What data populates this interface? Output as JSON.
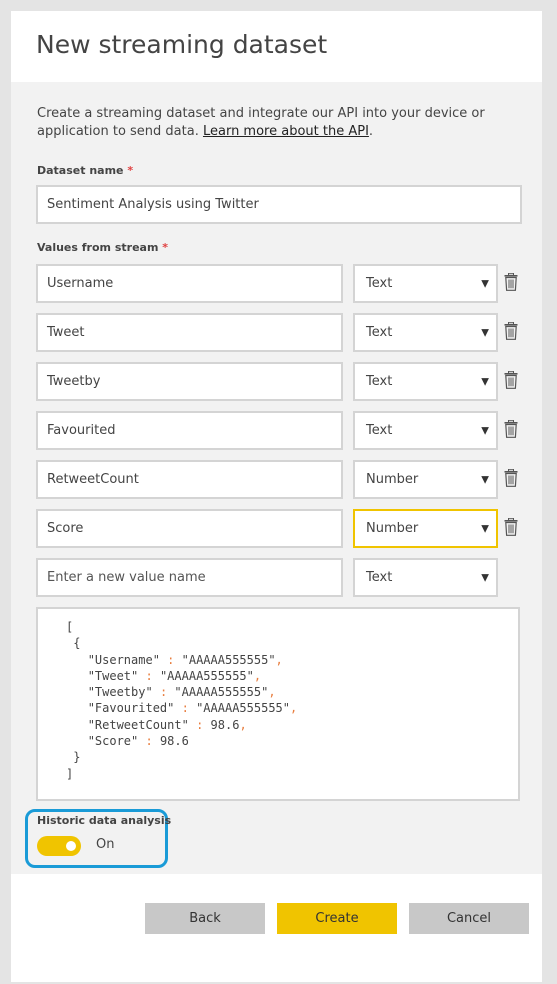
{
  "title": "New streaming dataset",
  "description": {
    "text": "Create a streaming dataset and integrate our API into your device or application to send data. ",
    "link": "Learn more about the API",
    "suffix": "."
  },
  "dataset_name": {
    "label": "Dataset name",
    "required_mark": "*",
    "value": "Sentiment Analysis using Twitter"
  },
  "values_from_stream": {
    "label": "Values from stream",
    "required_mark": "*",
    "rows": [
      {
        "name": "Username",
        "type": "Text"
      },
      {
        "name": "Tweet",
        "type": "Text"
      },
      {
        "name": "Tweetby",
        "type": "Text"
      },
      {
        "name": "Favourited",
        "type": "Text"
      },
      {
        "name": "RetweetCount",
        "type": "Number"
      },
      {
        "name": "Score",
        "type": "Number"
      }
    ],
    "new_value_placeholder": "Enter a new value name",
    "new_value_type": "Text"
  },
  "json_preview": {
    "open_bracket": "[",
    "open_brace": " {",
    "lines": [
      {
        "key": "\"Username\"",
        "value": "\"AAAAA555555\"",
        "comma": ","
      },
      {
        "key": "\"Tweet\"",
        "value": "\"AAAAA555555\"",
        "comma": ","
      },
      {
        "key": "\"Tweetby\"",
        "value": "\"AAAAA555555\"",
        "comma": ","
      },
      {
        "key": "\"Favourited\"",
        "value": "\"AAAAA555555\"",
        "comma": ","
      },
      {
        "key": "\"RetweetCount\"",
        "value": "98.6",
        "comma": ","
      },
      {
        "key": "\"Score\"",
        "value": "98.6",
        "comma": ""
      }
    ],
    "close_brace": " }",
    "close_bracket": "]"
  },
  "historic": {
    "label": "Historic data analysis",
    "state": "On",
    "enabled": true
  },
  "buttons": {
    "back": "Back",
    "create": "Create",
    "cancel": "Cancel"
  },
  "colors": {
    "accent": "#f0c400",
    "highlight": "#1a9bd7",
    "required": "#e04040",
    "json_punct": "#e87d3e"
  },
  "icons": {
    "delete": "trash-icon",
    "dropdown": "chevron-down-icon"
  }
}
